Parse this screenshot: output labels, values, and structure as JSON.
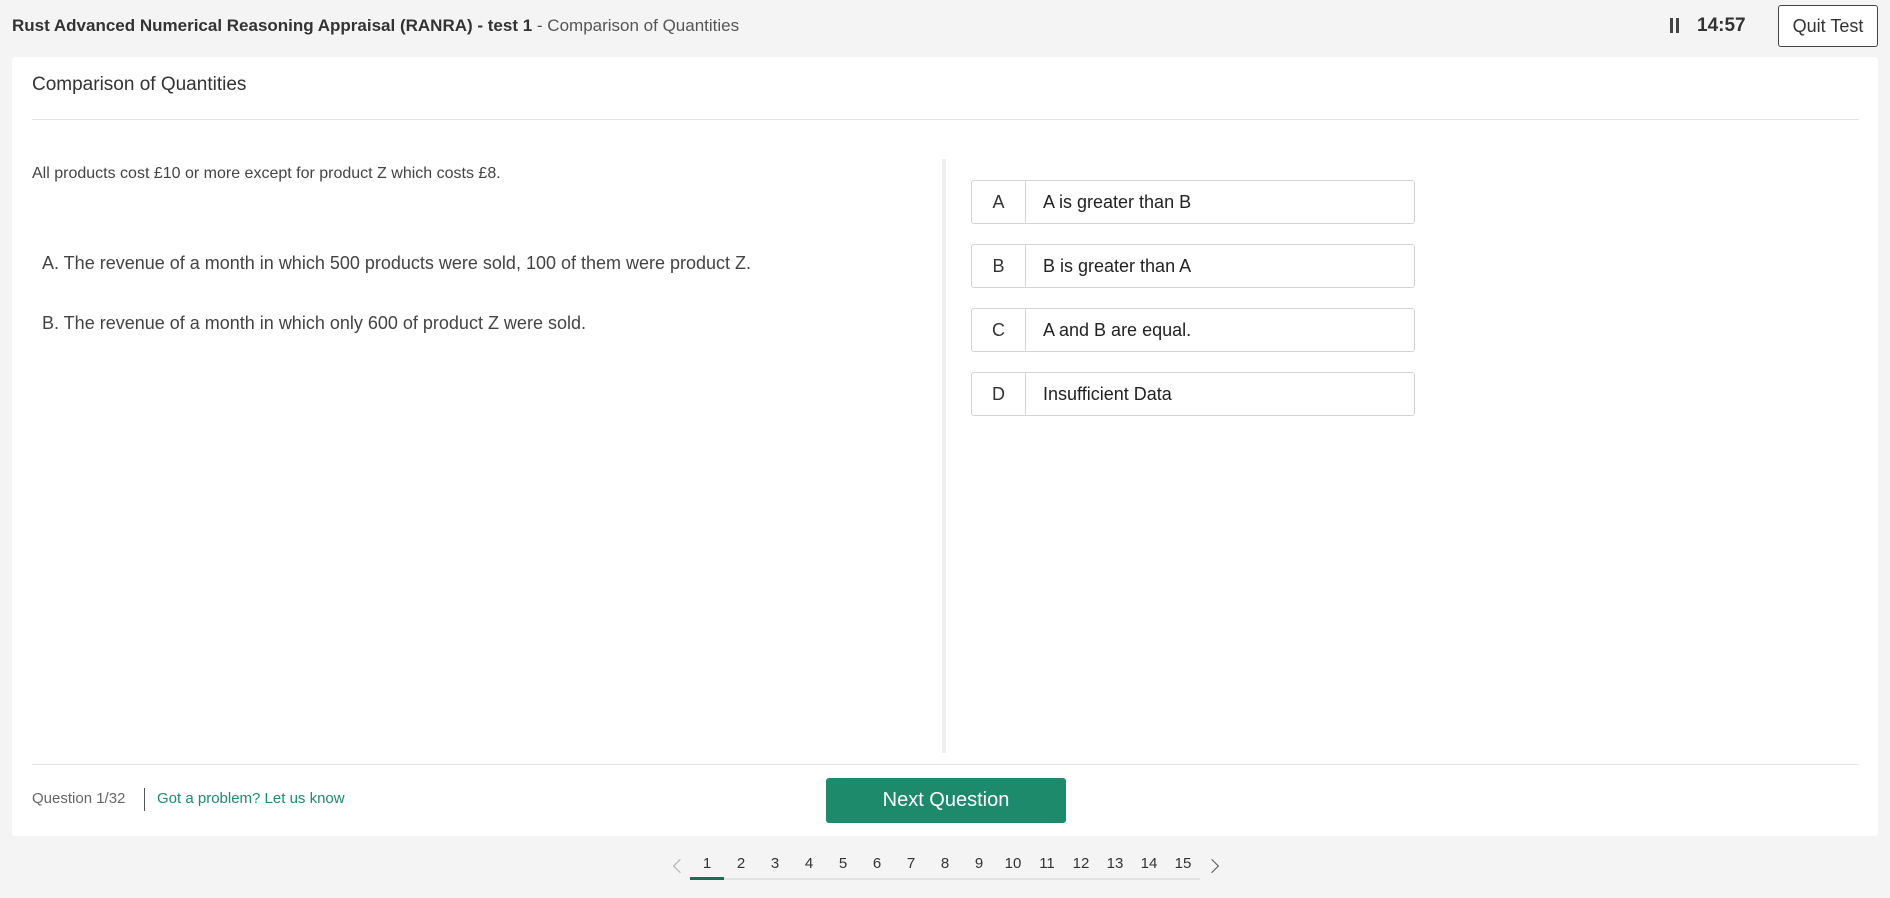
{
  "header": {
    "test_name": "Rust Advanced Numerical Reasoning Appraisal (RANRA) - test 1",
    "separator": " - ",
    "section_name": "Comparison of Quantities",
    "timer": "14:57",
    "quit_label": "Quit Test"
  },
  "card": {
    "title": "Comparison of Quantities",
    "intro": "All products cost £10 or more except for product Z which costs £8.",
    "statement_a": "A. The revenue of a month in which 500 products were sold, 100 of them were product Z.",
    "statement_b": "B. The revenue of a month in which only 600 of product Z were sold.",
    "options": [
      {
        "letter": "A",
        "text": "A is greater than B"
      },
      {
        "letter": "B",
        "text": "B is greater than A"
      },
      {
        "letter": "C",
        "text": "A and B are equal."
      },
      {
        "letter": "D",
        "text": "Insufficient Data"
      }
    ]
  },
  "footer": {
    "question_counter": "Question 1/32",
    "problem_link": "Got a problem? Let us know",
    "next_label": "Next Question"
  },
  "pagination": {
    "current": "1",
    "pages": [
      "1",
      "2",
      "3",
      "4",
      "5",
      "6",
      "7",
      "8",
      "9",
      "10",
      "11",
      "12",
      "13",
      "14",
      "15"
    ]
  },
  "colors": {
    "accent": "#1d8a6c",
    "link": "#1e8a6e",
    "page_indicator": "#1b6b55"
  }
}
